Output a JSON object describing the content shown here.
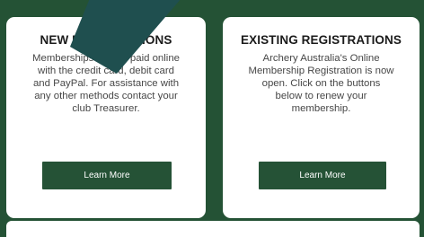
{
  "colors": {
    "background": "#245235",
    "card": "#ffffff",
    "button": "#255236",
    "arrow": "#1f4f4f"
  },
  "overlay": {
    "icon": "arrow-icon"
  },
  "cards": {
    "new": {
      "title": "NEW REGISTRATIONS",
      "lines": [
        "Memberships can be paid online",
        "with the credit card, debit card",
        "and PayPal. For assistance with",
        "any other methods contact your",
        "club Treasurer."
      ],
      "button_label": "Learn More"
    },
    "existing": {
      "title": "EXISTING REGISTRATIONS",
      "lines": [
        "Archery Australia's Online",
        "Membership Registration is now",
        "open. Click on the buttons",
        "below to renew your",
        "membership."
      ],
      "button_label": "Learn More"
    }
  }
}
